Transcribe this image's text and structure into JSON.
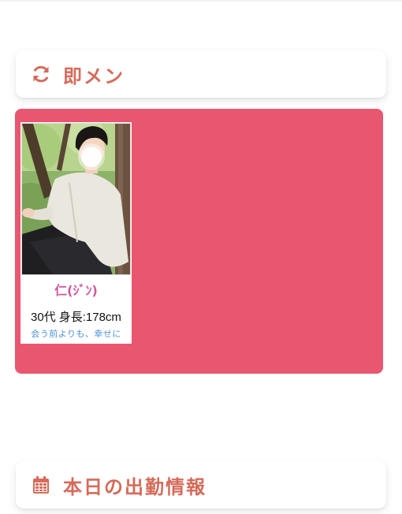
{
  "colors": {
    "accent": "#d56b5a",
    "panel_bg": "#e95670",
    "name_color": "#d0579c",
    "catch_color": "#4a90d9"
  },
  "sections": {
    "instant": {
      "title": "即メン",
      "icon": "refresh-icon"
    },
    "today_schedule": {
      "title": "本日の出勤情報",
      "icon": "calendar-icon"
    }
  },
  "cast": {
    "name": "仁(ｼﾞﾝ)",
    "age": "30代",
    "height": "身長:178cm",
    "catchphrase": "会う前よりも、幸せに"
  }
}
